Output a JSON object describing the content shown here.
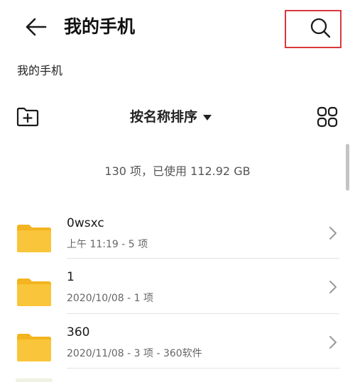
{
  "header": {
    "title": "我的手机"
  },
  "breadcrumb": {
    "path": "我的手机"
  },
  "toolbar": {
    "sort_label": "按名称排序"
  },
  "summary": {
    "text": "130 项，已使用 112.92 GB"
  },
  "files": [
    {
      "name": "0wsxc",
      "meta": "上午 11:19  - 5 项"
    },
    {
      "name": "1",
      "meta": "2020/10/08 - 1 项"
    },
    {
      "name": "360",
      "meta": "2020/11/08 - 3 项 - 360软件"
    }
  ],
  "colors": {
    "folder": "#f9c53a",
    "folder_tab": "#f3b41f",
    "highlight": "#d9383a"
  }
}
